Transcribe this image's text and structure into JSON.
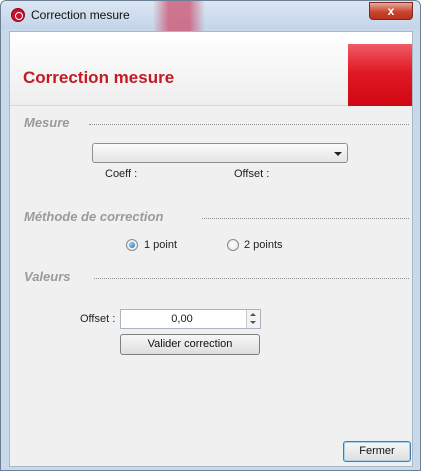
{
  "window": {
    "title": "Correction mesure",
    "close_glyph": "x"
  },
  "header": {
    "title": "Correction mesure",
    "accent_color": "#c21b24"
  },
  "mesure": {
    "section_label": "Mesure",
    "combo_value": "",
    "coeff_label": "Coeff :",
    "coeff_value": "",
    "offset_label": "Offset :",
    "offset_value": ""
  },
  "methode": {
    "section_label": "Méthode de correction",
    "options": [
      {
        "label": "1 point",
        "checked": true
      },
      {
        "label": "2 points",
        "checked": false
      }
    ]
  },
  "valeurs": {
    "section_label": "Valeurs",
    "offset_label": "Offset :",
    "offset_value": "0,00",
    "validate_label": "Valider correction"
  },
  "footer": {
    "close_label": "Fermer"
  },
  "icons": {
    "app": "app-logo-icon",
    "combo": "chevron-down-icon",
    "spin_up": "spin-up-icon",
    "spin_down": "spin-down-icon"
  }
}
